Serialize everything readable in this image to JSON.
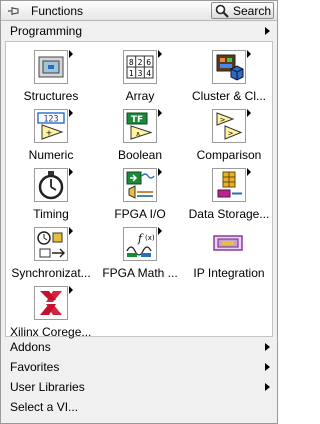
{
  "titlebar": {
    "title": "Functions",
    "search_label": "Search"
  },
  "categories": {
    "programming": "Programming",
    "addons": "Addons",
    "favorites": "Favorites",
    "user_libraries": "User Libraries",
    "select_vi": "Select a VI..."
  },
  "programming_items": [
    {
      "label": "Structures",
      "icon": "structures-icon"
    },
    {
      "label": "Array",
      "icon": "array-icon"
    },
    {
      "label": "Cluster & Cl...",
      "icon": "cluster-icon"
    },
    {
      "label": "Numeric",
      "icon": "numeric-icon"
    },
    {
      "label": "Boolean",
      "icon": "boolean-icon"
    },
    {
      "label": "Comparison",
      "icon": "comparison-icon"
    },
    {
      "label": "Timing",
      "icon": "timing-icon"
    },
    {
      "label": "FPGA I/O",
      "icon": "fpga-io-icon"
    },
    {
      "label": "Data Storage...",
      "icon": "data-storage-icon"
    },
    {
      "label": "Synchronizat...",
      "icon": "synchronization-icon"
    },
    {
      "label": "FPGA Math ...",
      "icon": "fpga-math-icon"
    },
    {
      "label": "IP Integration",
      "icon": "ip-integration-icon"
    },
    {
      "label": "Xilinx Corege...",
      "icon": "xilinx-coregen-icon"
    }
  ],
  "array_icon_text": [
    "8",
    "2",
    "6",
    "1",
    "3",
    "4"
  ],
  "numeric_icon_text": "123",
  "boolean_icon_text": "TF",
  "colors": {
    "accent": "#2a6cc4",
    "fpga_green": "#1a8a3a",
    "xilinx_red": "#c8102e"
  }
}
